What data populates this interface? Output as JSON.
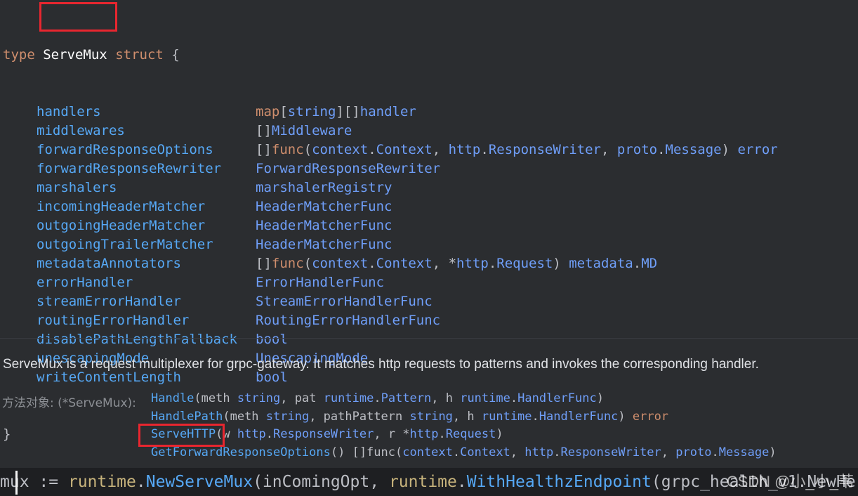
{
  "code": {
    "keyword_type": "type",
    "type_name": "ServeMux",
    "keyword_struct": "struct",
    "open_brace": "{",
    "close_brace": "}",
    "fields": [
      {
        "name": "handlers",
        "type_parts": [
          [
            "kw",
            "map"
          ],
          [
            "txt",
            "["
          ],
          [
            "typ",
            "string"
          ],
          [
            "txt",
            "][]"
          ],
          [
            "typ",
            "handler"
          ]
        ]
      },
      {
        "name": "middlewares",
        "type_parts": [
          [
            "txt",
            "[]"
          ],
          [
            "typ",
            "Middleware"
          ]
        ]
      },
      {
        "name": "forwardResponseOptions",
        "type_parts": [
          [
            "txt",
            "[]"
          ],
          [
            "kw",
            "func"
          ],
          [
            "txt",
            "("
          ],
          [
            "typ",
            "context"
          ],
          [
            "txt",
            "."
          ],
          [
            "typ",
            "Context"
          ],
          [
            "txt",
            ", "
          ],
          [
            "typ",
            "http"
          ],
          [
            "txt",
            "."
          ],
          [
            "typ",
            "ResponseWriter"
          ],
          [
            "txt",
            ", "
          ],
          [
            "typ",
            "proto"
          ],
          [
            "txt",
            "."
          ],
          [
            "typ",
            "Message"
          ],
          [
            "txt",
            ") "
          ],
          [
            "typ",
            "error"
          ]
        ]
      },
      {
        "name": "forwardResponseRewriter",
        "type_parts": [
          [
            "typ",
            "ForwardResponseRewriter"
          ]
        ]
      },
      {
        "name": "marshalers",
        "type_parts": [
          [
            "typ",
            "marshalerRegistry"
          ]
        ]
      },
      {
        "name": "incomingHeaderMatcher",
        "type_parts": [
          [
            "typ",
            "HeaderMatcherFunc"
          ]
        ]
      },
      {
        "name": "outgoingHeaderMatcher",
        "type_parts": [
          [
            "typ",
            "HeaderMatcherFunc"
          ]
        ]
      },
      {
        "name": "outgoingTrailerMatcher",
        "type_parts": [
          [
            "typ",
            "HeaderMatcherFunc"
          ]
        ]
      },
      {
        "name": "metadataAnnotators",
        "type_parts": [
          [
            "txt",
            "[]"
          ],
          [
            "kw",
            "func"
          ],
          [
            "txt",
            "("
          ],
          [
            "typ",
            "context"
          ],
          [
            "txt",
            "."
          ],
          [
            "typ",
            "Context"
          ],
          [
            "txt",
            ", *"
          ],
          [
            "typ",
            "http"
          ],
          [
            "txt",
            "."
          ],
          [
            "typ",
            "Request"
          ],
          [
            "txt",
            ") "
          ],
          [
            "typ",
            "metadata"
          ],
          [
            "txt",
            "."
          ],
          [
            "typ",
            "MD"
          ]
        ]
      },
      {
        "name": "errorHandler",
        "type_parts": [
          [
            "typ",
            "ErrorHandlerFunc"
          ]
        ]
      },
      {
        "name": "streamErrorHandler",
        "type_parts": [
          [
            "typ",
            "StreamErrorHandlerFunc"
          ]
        ]
      },
      {
        "name": "routingErrorHandler",
        "type_parts": [
          [
            "typ",
            "RoutingErrorHandlerFunc"
          ]
        ]
      },
      {
        "name": "disablePathLengthFallback",
        "type_parts": [
          [
            "typ",
            "bool"
          ]
        ]
      },
      {
        "name": "unescapingMode",
        "type_parts": [
          [
            "typ",
            "UnescapingMode"
          ]
        ]
      },
      {
        "name": "writeContentLength",
        "type_parts": [
          [
            "typ",
            "bool"
          ]
        ]
      }
    ]
  },
  "description": "ServeMux is a request multiplexer for grpc-gateway. It matches http requests to patterns and invokes the corresponding handler.",
  "methods_label": "方法对象: (*ServeMux):",
  "methods": [
    {
      "parts": [
        [
          "mname",
          "Handle"
        ],
        [
          "param",
          "(meth "
        ],
        [
          "mtype",
          "string"
        ],
        [
          "param",
          ", pat "
        ],
        [
          "mtype",
          "runtime"
        ],
        [
          "param",
          "."
        ],
        [
          "mtype",
          "Pattern"
        ],
        [
          "param",
          ", h "
        ],
        [
          "mtype",
          "runtime"
        ],
        [
          "param",
          "."
        ],
        [
          "mtype",
          "HandlerFunc"
        ],
        [
          "param",
          ")"
        ]
      ]
    },
    {
      "parts": [
        [
          "mname",
          "HandlePath"
        ],
        [
          "param",
          "(meth "
        ],
        [
          "mtype",
          "string"
        ],
        [
          "param",
          ", pathPattern "
        ],
        [
          "mtype",
          "string"
        ],
        [
          "param",
          ", h "
        ],
        [
          "mtype",
          "runtime"
        ],
        [
          "param",
          "."
        ],
        [
          "mtype",
          "HandlerFunc"
        ],
        [
          "param",
          ") "
        ],
        [
          "mkw",
          "error"
        ]
      ]
    },
    {
      "parts": [
        [
          "mname",
          "ServeHTTP"
        ],
        [
          "param",
          "(w "
        ],
        [
          "mtype",
          "http"
        ],
        [
          "param",
          "."
        ],
        [
          "mtype",
          "ResponseWriter"
        ],
        [
          "param",
          ", r *"
        ],
        [
          "mtype",
          "http"
        ],
        [
          "param",
          "."
        ],
        [
          "mtype",
          "Request"
        ],
        [
          "param",
          ")"
        ]
      ]
    },
    {
      "parts": [
        [
          "mname",
          "GetForwardResponseOptions"
        ],
        [
          "param",
          "() []func("
        ],
        [
          "mtype",
          "context"
        ],
        [
          "param",
          "."
        ],
        [
          "mtype",
          "Context"
        ],
        [
          "param",
          ", "
        ],
        [
          "mtype",
          "http"
        ],
        [
          "param",
          "."
        ],
        [
          "mtype",
          "ResponseWriter"
        ],
        [
          "param",
          ", "
        ],
        [
          "mtype",
          "proto"
        ],
        [
          "param",
          "."
        ],
        [
          "mtype",
          "Message"
        ],
        [
          "param",
          ")"
        ]
      ]
    }
  ],
  "editor_line": {
    "parts": [
      [
        "ident",
        "mux := "
      ],
      [
        "pkg",
        "runtime"
      ],
      [
        "ident",
        "."
      ],
      [
        "fn",
        "NewServeMux"
      ],
      [
        "ident",
        "(inComingOpt, "
      ],
      [
        "pkg",
        "runtime"
      ],
      [
        "ident",
        "."
      ],
      [
        "fn",
        "WithHealthzEndpoint"
      ],
      [
        "ident",
        "(grpc_health_v1.NewHe"
      ]
    ]
  },
  "watermark": "CSDN @小_小_苇",
  "colors": {
    "background": "#2b2d30",
    "keyword": "#cf8e6d",
    "field": "#56a8f5",
    "type": "#6f9ef8",
    "highlight_box": "#e8262f"
  }
}
